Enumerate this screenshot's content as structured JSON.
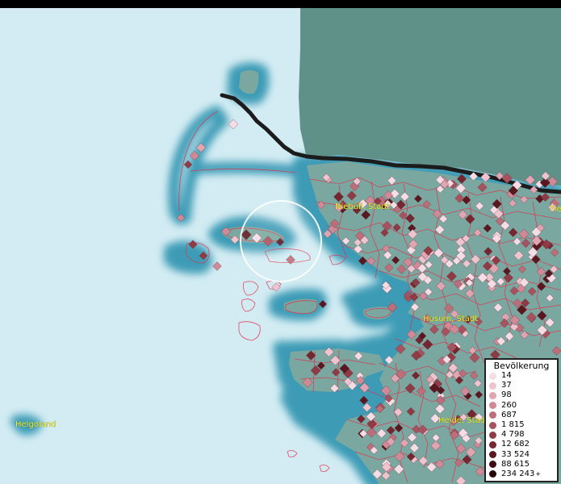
{
  "places": {
    "niebuell": "Niebüll, Stadt",
    "husum": "Husum, Stadt",
    "heide": "Heide, Stadt",
    "helgoland": "Helgoland",
    "flensburg_partial": "Fle"
  },
  "legend": {
    "title": "Bevölkerung",
    "items": [
      {
        "label": "14",
        "color": "#f6dde5"
      },
      {
        "label": "37",
        "color": "#eec4cf"
      },
      {
        "label": "98",
        "color": "#e1a5b1"
      },
      {
        "label": "260",
        "color": "#d08996"
      },
      {
        "label": "687",
        "color": "#bd6e7b"
      },
      {
        "label": "1 815",
        "color": "#a7535f"
      },
      {
        "label": "4 798",
        "color": "#8e3b46"
      },
      {
        "label": "12 682",
        "color": "#742631"
      },
      {
        "label": "33 524",
        "color": "#591820"
      },
      {
        "label": "88 615",
        "color": "#3f0d13"
      },
      {
        "label": "234 243",
        "color": "#240308",
        "suffix": "+"
      }
    ]
  },
  "colors": {
    "sea": "#d3ecf3",
    "shallow_water": "#3e9bb6",
    "land": "#7aa8a0",
    "denmark": "#5f9188",
    "boundary": "#e0304b",
    "border": "#1c1c1c",
    "label": "#f2f22a"
  }
}
